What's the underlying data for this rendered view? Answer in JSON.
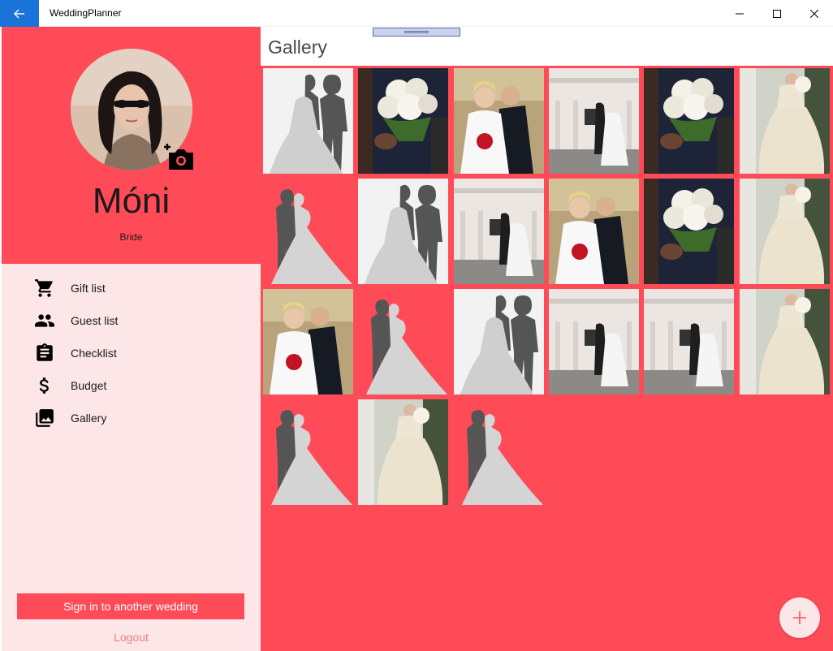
{
  "window": {
    "title": "WeddingPlanner",
    "controls": [
      "minimize",
      "maximize",
      "close"
    ]
  },
  "profile": {
    "name": "Móni",
    "role": "Bride"
  },
  "menu": [
    {
      "label": "Gift list",
      "icon": "cart-icon"
    },
    {
      "label": "Guest list",
      "icon": "people-icon"
    },
    {
      "label": "Checklist",
      "icon": "clipboard-icon"
    },
    {
      "label": "Budget",
      "icon": "dollar-icon"
    },
    {
      "label": "Gallery",
      "icon": "gallery-icon"
    }
  ],
  "actions": {
    "signin_label": "Sign in to another wedding",
    "logout_label": "Logout"
  },
  "main": {
    "title": "Gallery"
  },
  "gallery": {
    "columns": 6,
    "photos": [
      "silhouette-gray",
      "bouquet",
      "couple",
      "building-couple",
      "bouquet",
      "dress",
      "silhouette-kiss",
      "silhouette-gray",
      "building-couple",
      "couple",
      "bouquet",
      "dress",
      "couple",
      "silhouette-kiss",
      "silhouette-gray",
      "building-couple",
      "building-couple",
      "dress",
      "silhouette-kiss",
      "dress",
      "silhouette-kiss"
    ]
  },
  "colors": {
    "accent": "#ff4b57",
    "sidebar_bg": "#fce6e7",
    "back_button": "#1a73d9"
  }
}
